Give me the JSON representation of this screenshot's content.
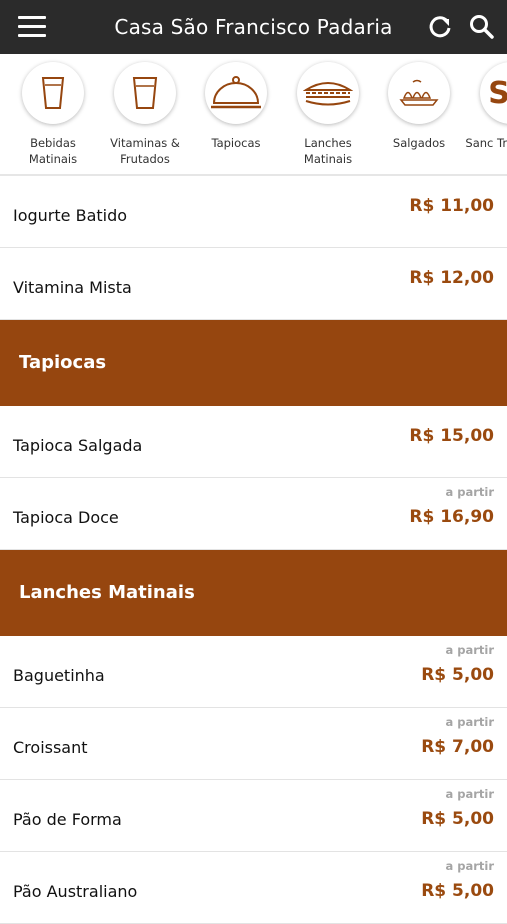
{
  "header": {
    "title": "Casa São Francisco Padaria"
  },
  "categories": [
    {
      "label": "Bebidas Matinais",
      "icon": "glass-icon"
    },
    {
      "label": "Vitaminas & Frutados",
      "icon": "cup-icon"
    },
    {
      "label": "Tapiocas",
      "icon": "cloche-icon"
    },
    {
      "label": "Lanches Matinais",
      "icon": "sandwich-icon"
    },
    {
      "label": "Salgados",
      "icon": "pastry-tray-icon"
    },
    {
      "label": "Sanc Tradi",
      "icon": "partial-icon"
    }
  ],
  "items_top": [
    {
      "name": "Iogurte Batido",
      "price": "R$ 11,00"
    },
    {
      "name": "Vitamina Mista",
      "price": "R$ 12,00"
    }
  ],
  "section_tapiocas": {
    "title": "Tapiocas",
    "items": [
      {
        "name": "Tapioca Salgada",
        "price": "R$ 15,00"
      },
      {
        "name": "Tapioca Doce",
        "from": "a partir",
        "price": "R$ 16,90"
      }
    ]
  },
  "section_lanches": {
    "title": "Lanches Matinais",
    "items": [
      {
        "name": "Baguetinha",
        "from": "a partir",
        "price": "R$ 5,00"
      },
      {
        "name": "Croissant",
        "from": "a partir",
        "price": "R$ 7,00"
      },
      {
        "name": "Pão de Forma",
        "from": "a partir",
        "price": "R$ 5,00"
      },
      {
        "name": "Pão Australiano",
        "from": "a partir",
        "price": "R$ 5,00"
      }
    ]
  },
  "colors": {
    "header_bg": "#2b2b2b",
    "accent": "#96460f",
    "price": "#9a4a0f"
  }
}
